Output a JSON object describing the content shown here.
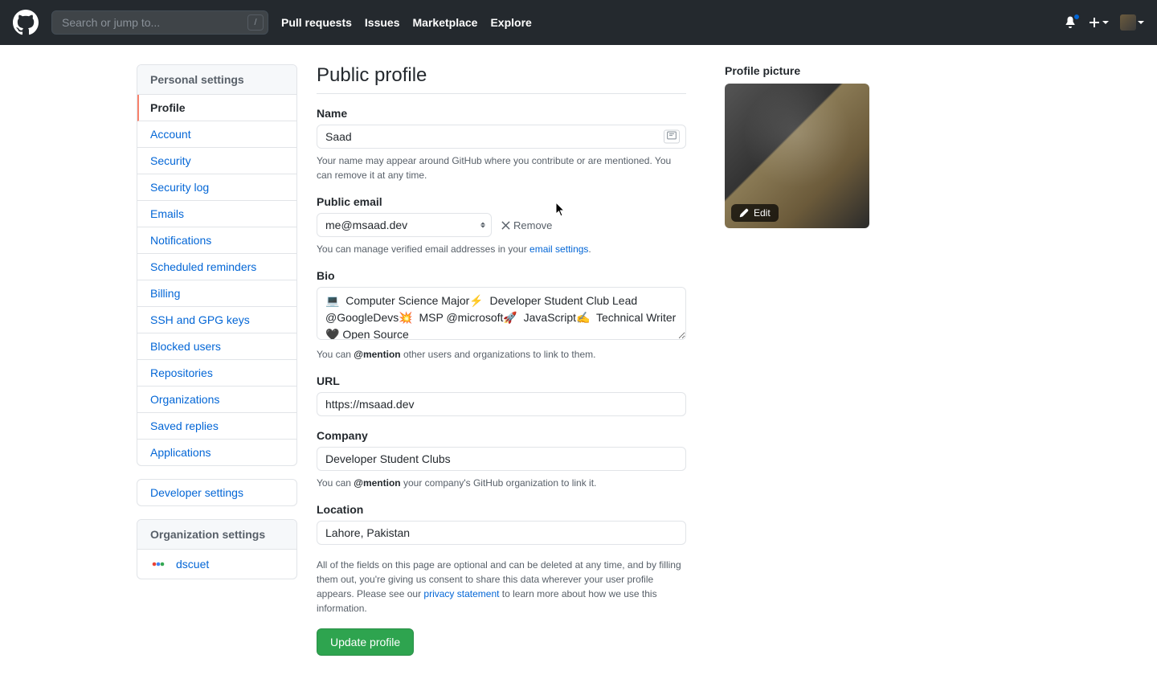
{
  "topbar": {
    "search_placeholder": "Search or jump to...",
    "slash": "/",
    "nav": [
      "Pull requests",
      "Issues",
      "Marketplace",
      "Explore"
    ]
  },
  "sidebar": {
    "personal_header": "Personal settings",
    "items": [
      "Profile",
      "Account",
      "Security",
      "Security log",
      "Emails",
      "Notifications",
      "Scheduled reminders",
      "Billing",
      "SSH and GPG keys",
      "Blocked users",
      "Repositories",
      "Organizations",
      "Saved replies",
      "Applications"
    ],
    "developer": "Developer settings",
    "org_header": "Organization settings",
    "org_name": "dscuet"
  },
  "page": {
    "title": "Public profile",
    "name_label": "Name",
    "name_value": "Saad",
    "name_hint": "Your name may appear around GitHub where you contribute or are mentioned. You can remove it at any time.",
    "email_label": "Public email",
    "email_value": "me@msaad.dev",
    "remove": "Remove",
    "email_hint_pre": "You can manage verified email addresses in your ",
    "email_hint_link": "email settings",
    "bio_label": "Bio",
    "bio_value": "💻  Computer Science Major⚡  Developer Student Club Lead @GoogleDevs💥  MSP @microsoft🚀  JavaScript✍  Technical Writer  🖤 Open Source",
    "bio_hint_pre": "You can ",
    "bio_hint_mention": "@mention",
    "bio_hint_post": " other users and organizations to link to them.",
    "url_label": "URL",
    "url_value": "https://msaad.dev",
    "company_label": "Company",
    "company_value": "Developer Student Clubs",
    "company_hint_pre": "You can ",
    "company_hint_mention": "@mention",
    "company_hint_post": " your company's GitHub organization to link it.",
    "location_label": "Location",
    "location_value": "Lahore, Pakistan",
    "footer_pre": "All of the fields on this page are optional and can be deleted at any time, and by filling them out, you're giving us consent to share this data wherever your user profile appears. Please see our ",
    "footer_link": "privacy statement",
    "footer_post": " to learn more about how we use this information.",
    "update_btn": "Update profile",
    "pic_label": "Profile picture",
    "edit": "Edit"
  }
}
